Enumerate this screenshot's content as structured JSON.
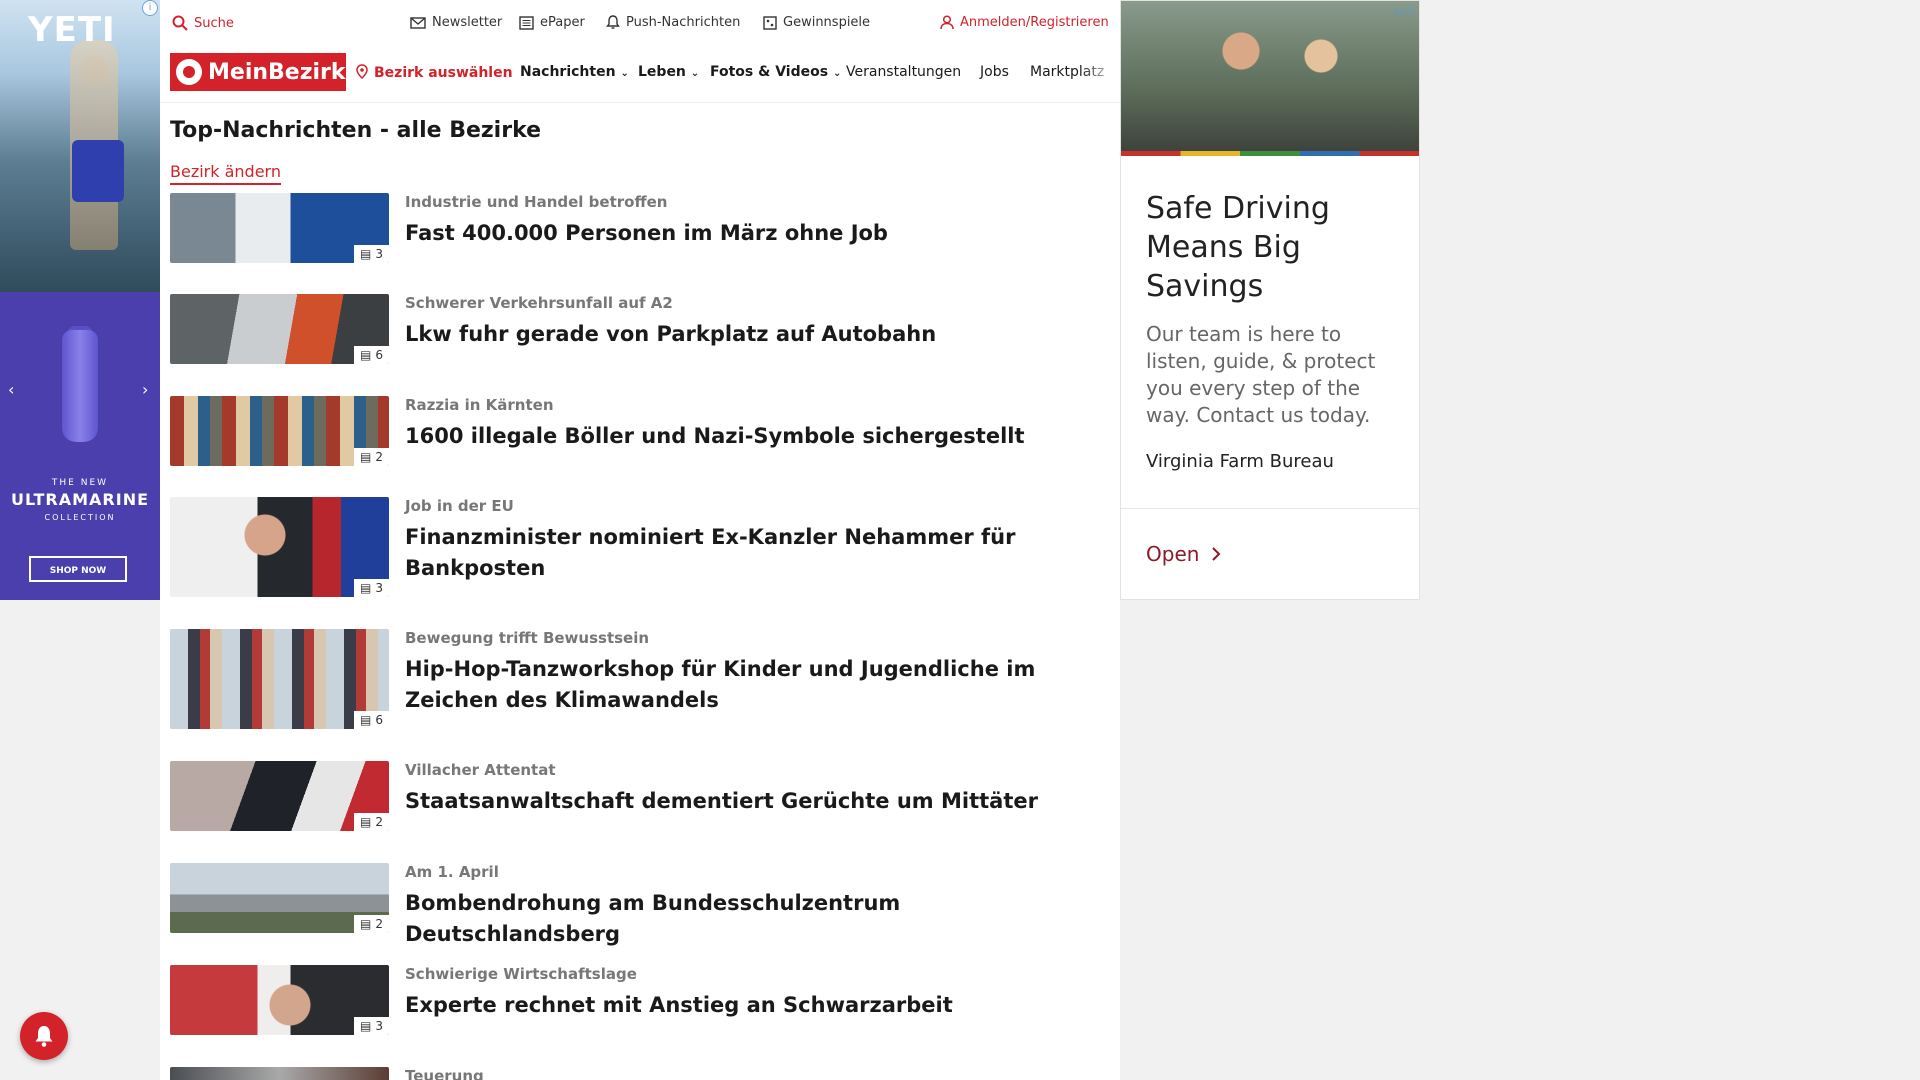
{
  "left_ad": {
    "brand": "YETI",
    "new_label": "THE NEW",
    "collection_name": "ULTRAMARINE",
    "collection_label": "COLLECTION",
    "cta": "SHOP NOW",
    "info_icon": "info-icon",
    "prev_icon": "chevron-left-icon",
    "next_icon": "chevron-right-icon"
  },
  "utility_bar": {
    "search_label": "Suche",
    "newsletter_label": "Newsletter",
    "epaper_label": "ePaper",
    "push_label": "Push-Nachrichten",
    "gewinnspiele_label": "Gewinnspiele",
    "login_label": "Anmelden/Registrieren"
  },
  "nav": {
    "logo_text": "MeinBezirk",
    "bezirk_label": "Bezirk auswählen",
    "items": [
      {
        "label": "Nachrichten",
        "dropdown": true
      },
      {
        "label": "Leben",
        "dropdown": true
      },
      {
        "label": "Fotos & Videos",
        "dropdown": true
      },
      {
        "label": "Veranstaltungen",
        "dropdown": false
      },
      {
        "label": "Jobs",
        "dropdown": false
      },
      {
        "label": "Marktplatz",
        "dropdown": false
      }
    ]
  },
  "page": {
    "title": "Top-Nachrichten - alle Bezirke",
    "change_link": "Bezirk ändern"
  },
  "articles": [
    {
      "kicker": "Industrie und Handel betroffen",
      "headline": "Fast 400.000 Personen im März ohne Job",
      "image_count": "3"
    },
    {
      "kicker": "Schwerer Verkehrsunfall auf A2",
      "headline": "Lkw fuhr gerade von Parkplatz auf Autobahn",
      "image_count": "6"
    },
    {
      "kicker": "Razzia in Kärnten",
      "headline": "1600 illegale Böller und Nazi-Symbole sichergestellt",
      "image_count": "2"
    },
    {
      "kicker": "Job in der EU",
      "headline": "Finanzminister nominiert Ex-Kanzler Nehammer für Bankposten",
      "image_count": "3"
    },
    {
      "kicker": "Bewegung trifft Bewusstsein",
      "headline": "Hip-Hop-Tanzworkshop für Kinder und Jugendliche im Zeichen des Klimawandels",
      "image_count": "6"
    },
    {
      "kicker": "Villacher Attentat",
      "headline": "Staatsanwaltschaft dementiert Gerüchte um Mittäter",
      "image_count": "2"
    },
    {
      "kicker": "Am 1. April",
      "headline": "Bombendrohung am Bundesschulzentrum Deutschlandsberg",
      "image_count": "2"
    },
    {
      "kicker": "Schwierige Wirtschaftslage",
      "headline": "Experte rechnet mit Anstieg an Schwarzarbeit",
      "image_count": "3"
    },
    {
      "kicker": "Teuerung",
      "headline": "",
      "image_count": ""
    }
  ],
  "right_ad": {
    "headline": "Safe Driving Means Big Savings",
    "body": "Our team is here to listen, guide, & protect you every step of the way. Contact us today.",
    "sponsor": "Virginia Farm Bureau",
    "cta": "Open"
  },
  "colors": {
    "brand_red": "#d3222a",
    "ad_purple": "#4a3fad",
    "ad_link": "#8b1a2a"
  }
}
